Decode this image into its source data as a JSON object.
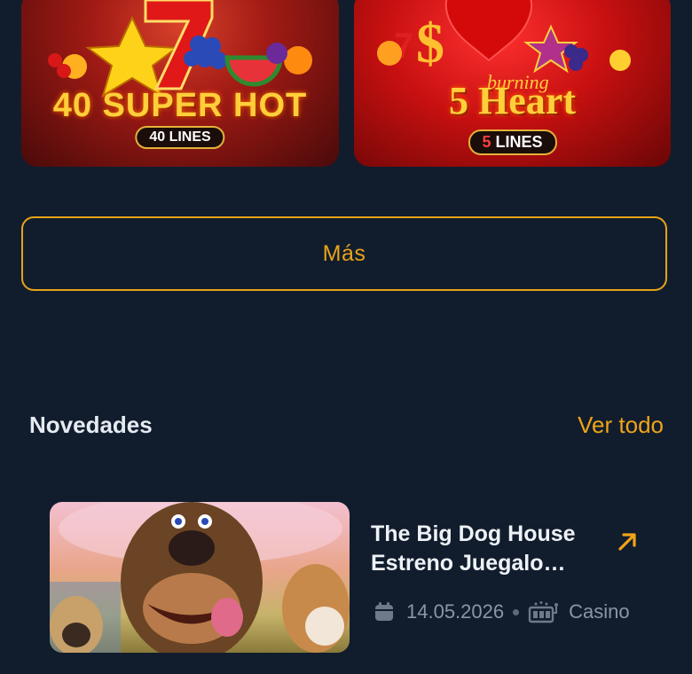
{
  "games": [
    {
      "title": "40 SUPER HOT",
      "subtitle": "40 LINES"
    },
    {
      "title_small": "burning",
      "title": "5 Heart",
      "subtitle_num": "5",
      "subtitle_word": "LINES"
    }
  ],
  "more_button": {
    "label": "Más"
  },
  "news_section": {
    "title": "Novedades",
    "see_all": "Ver todo",
    "items": [
      {
        "title_line1": "The Big Dog House",
        "title_line2": "Estreno Juegalo…",
        "date": "14.05.2026",
        "category": "Casino"
      }
    ]
  },
  "colors": {
    "background": "#111d2d",
    "accent": "#e8a318",
    "text": "#eef2f6",
    "muted": "#8a96a6"
  },
  "icons": [
    "arrow-up-right-icon",
    "calendar-icon",
    "slot-machine-icon"
  ]
}
